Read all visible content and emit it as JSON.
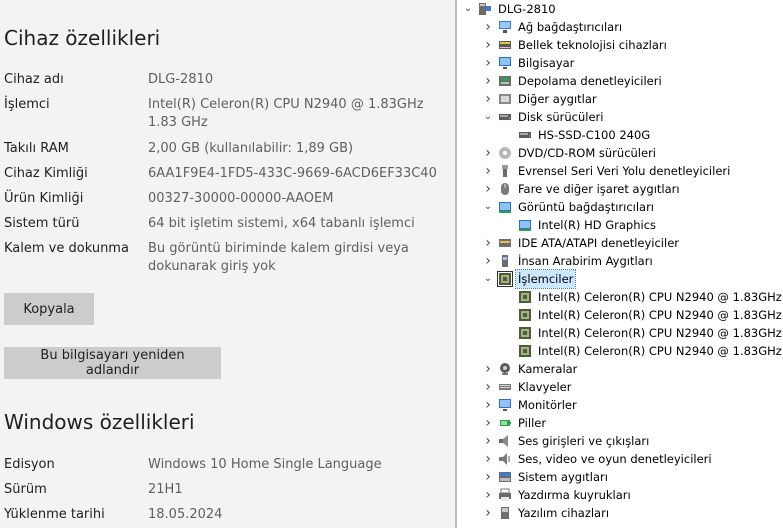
{
  "settings": {
    "device_specs_title": "Cihaz özellikleri",
    "rows": [
      {
        "label": "Cihaz adı",
        "value": "DLG-2810"
      },
      {
        "label": "İşlemci",
        "value": "Intel(R) Celeron(R) CPU  N2940  @ 1.83GHz   1.83 GHz"
      },
      {
        "label": "Takılı RAM",
        "value": "2,00 GB (kullanılabilir: 1,89 GB)"
      },
      {
        "label": "Cihaz Kimliği",
        "value": "6AA1F9E4-1FD5-433C-9669-6ACD6EF33C40"
      },
      {
        "label": "Ürün Kimliği",
        "value": "00327-30000-00000-AAOEM"
      },
      {
        "label": "Sistem türü",
        "value": "64 bit işletim sistemi, x64 tabanlı işlemci"
      },
      {
        "label": "Kalem ve dokunma",
        "value": "Bu görüntü biriminde kalem girdisi veya dokunarak giriş yok"
      }
    ],
    "copy_button": "Kopyala",
    "rename_button": "Bu bilgisayarı yeniden adlandır",
    "windows_specs_title": "Windows özellikleri",
    "windows_rows": [
      {
        "label": "Edisyon",
        "value": "Windows 10 Home Single Language"
      },
      {
        "label": "Sürüm",
        "value": "21H1"
      },
      {
        "label": "Yüklenme tarihi",
        "value": "18.05.2024"
      }
    ]
  },
  "device_manager": {
    "root": {
      "label": "DLG-2810",
      "icon": "computer-icon"
    },
    "nodes": [
      {
        "label": "Ağ bağdaştırıcıları",
        "level": 1,
        "expanded": false,
        "icon": "network-adapter-icon"
      },
      {
        "label": "Bellek teknolojisi cihazları",
        "level": 1,
        "expanded": false,
        "icon": "memory-tech-icon"
      },
      {
        "label": "Bilgisayar",
        "level": 1,
        "expanded": false,
        "icon": "monitor-icon"
      },
      {
        "label": "Depolama denetleyicileri",
        "level": 1,
        "expanded": false,
        "icon": "storage-controller-icon"
      },
      {
        "label": "Diğer aygıtlar",
        "level": 1,
        "expanded": false,
        "icon": "other-devices-icon"
      },
      {
        "label": "Disk sürücüleri",
        "level": 1,
        "expanded": true,
        "icon": "disk-drive-icon"
      },
      {
        "label": "HS-SSD-C100 240G",
        "level": 2,
        "icon": "disk-drive-icon"
      },
      {
        "label": "DVD/CD-ROM sürücüleri",
        "level": 1,
        "expanded": false,
        "icon": "dvd-drive-icon"
      },
      {
        "label": "Evrensel Seri Veri Yolu denetleyicileri",
        "level": 1,
        "expanded": false,
        "icon": "usb-icon"
      },
      {
        "label": "Fare ve diğer işaret aygıtları",
        "level": 1,
        "expanded": false,
        "icon": "mouse-icon"
      },
      {
        "label": "Görüntü bağdaştırıcıları",
        "level": 1,
        "expanded": true,
        "icon": "display-adapter-icon"
      },
      {
        "label": "Intel(R) HD Graphics",
        "level": 2,
        "icon": "display-adapter-icon"
      },
      {
        "label": "IDE ATA/ATAPI denetleyiciler",
        "level": 1,
        "expanded": false,
        "icon": "ide-controller-icon"
      },
      {
        "label": "İnsan Arabirim Aygıtları",
        "level": 1,
        "expanded": false,
        "icon": "hid-icon"
      },
      {
        "label": "İşlemciler",
        "level": 1,
        "expanded": true,
        "selected": true,
        "icon": "processor-icon"
      },
      {
        "label": "Intel(R) Celeron(R) CPU  N2940  @ 1.83GHz",
        "level": 2,
        "icon": "processor-icon"
      },
      {
        "label": "Intel(R) Celeron(R) CPU  N2940  @ 1.83GHz",
        "level": 2,
        "icon": "processor-icon"
      },
      {
        "label": "Intel(R) Celeron(R) CPU  N2940  @ 1.83GHz",
        "level": 2,
        "icon": "processor-icon"
      },
      {
        "label": "Intel(R) Celeron(R) CPU  N2940  @ 1.83GHz",
        "level": 2,
        "icon": "processor-icon"
      },
      {
        "label": "Kameralar",
        "level": 1,
        "expanded": false,
        "icon": "camera-icon"
      },
      {
        "label": "Klavyeler",
        "level": 1,
        "expanded": false,
        "icon": "keyboard-icon"
      },
      {
        "label": "Monitörler",
        "level": 1,
        "expanded": false,
        "icon": "monitor-icon"
      },
      {
        "label": "Piller",
        "level": 1,
        "expanded": false,
        "icon": "battery-icon"
      },
      {
        "label": "Ses girişleri ve çıkışları",
        "level": 1,
        "expanded": false,
        "icon": "speaker-icon"
      },
      {
        "label": "Ses, video ve oyun denetleyicileri",
        "level": 1,
        "expanded": false,
        "icon": "audio-controller-icon"
      },
      {
        "label": "Sistem aygıtları",
        "level": 1,
        "expanded": false,
        "icon": "system-devices-icon"
      },
      {
        "label": "Yazdırma kuyrukları",
        "level": 1,
        "expanded": false,
        "icon": "printer-icon"
      },
      {
        "label": "Yazılım cihazları",
        "level": 1,
        "expanded": false,
        "icon": "software-device-icon"
      }
    ]
  }
}
